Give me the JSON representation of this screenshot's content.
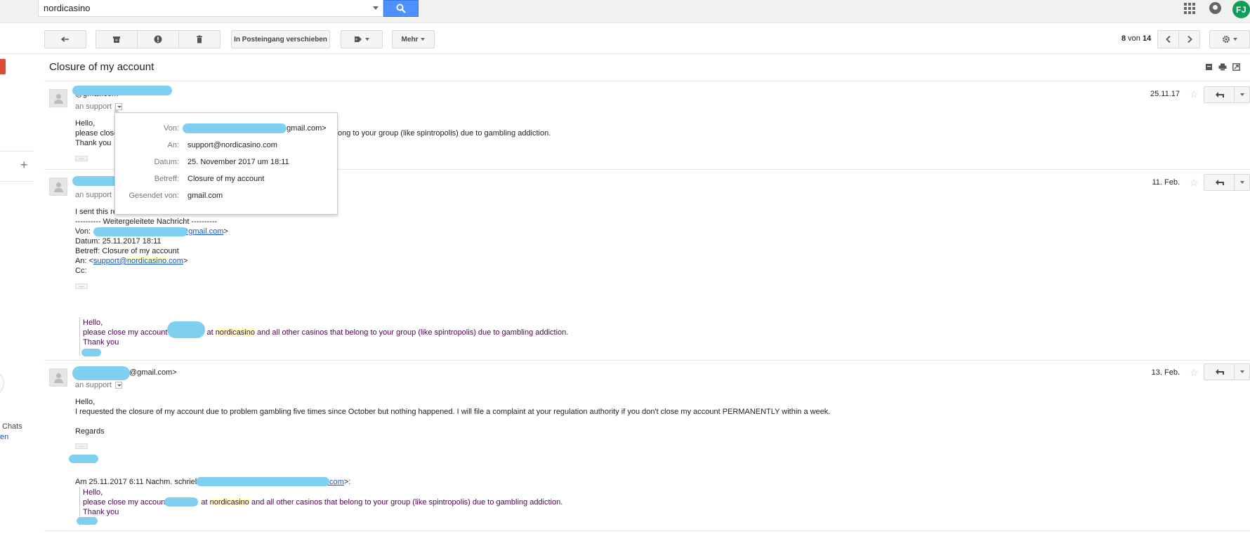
{
  "search": {
    "value": "nordicasino"
  },
  "account": {
    "initials": "FJ"
  },
  "toolbar": {
    "move_label": "In Posteingang verschieben",
    "more_label": "Mehr",
    "pager_current": "8",
    "pager_sep": " von ",
    "pager_total": "14"
  },
  "left": {
    "chats_label": "Chats",
    "partial_link": "en"
  },
  "thread": {
    "subject": "Closure of my account"
  },
  "messages": [
    {
      "sender": "@gmail.com>",
      "to": "an support",
      "date": "25.11.17",
      "lines": [
        "Hello,",
        "please close",
        "ong to your group (like spintropolis) due to gambling addiction.",
        "Thank you"
      ]
    },
    {
      "to": "an support",
      "date": "11. Feb.",
      "intro": "I sent this re",
      "fwd_header": "---------- Weitergeleitete Nachricht ----------",
      "from_label": "Von: ",
      "from_value": "@gmail.com",
      "from_close": ">",
      "date_line": "Datum: 25.11.2017 18:11",
      "subject_line": "Betreff: Closure of my account",
      "to_label": "An: <",
      "to_link_pre": "support@",
      "to_link_hl": "nordicasino",
      "to_link_post": ".com",
      "to_close": ">",
      "cc_line": "Cc:",
      "quote_hello": "Hello,",
      "quote_pre": "please close my account",
      "quote_at": "at ",
      "quote_hl": "nordicasino",
      "quote_post": " and all other casinos that belong to your group (like spintropolis) due to gambling addiction.",
      "quote_thanks": "Thank you"
    },
    {
      "sender": "@gmail.com>",
      "to": "an support",
      "date": "13. Feb.",
      "hello": "Hello,",
      "body": "I requested the closure of my account due to problem gambling five times since October but nothing happened. I will file a complaint at your regulation authority if you don't close my account PERMANENTLY within a week.",
      "regards": "Regards",
      "wrote_pre": "Am 25.11.2017 6:11 Nachm. schrieb",
      "wrote_link": ".com",
      "wrote_post": ">:",
      "quote_hello": "Hello,",
      "quote_pre": "please close my accoun",
      "quote_at": "at ",
      "quote_hl": "nordicasino",
      "quote_post": " and all other casinos that belong to your group (like spintropolis) due to gambling addiction.",
      "quote_thanks": "Thank you"
    }
  ],
  "popup": {
    "rows": [
      {
        "label": "Von:",
        "value": "@gmail.com>"
      },
      {
        "label": "An:",
        "value": "support@nordicasino.com"
      },
      {
        "label": "Datum:",
        "value": "25. November 2017 um 18:11"
      },
      {
        "label": "Betreff:",
        "value": "Closure of my account"
      },
      {
        "label": "Gesendet von:",
        "value": "gmail.com"
      }
    ]
  },
  "colors": {
    "accent_blue": "#4d90fe",
    "label_red": "#dd4b39",
    "avatar_green": "#0f9d58",
    "redaction": "#7fcff0"
  }
}
